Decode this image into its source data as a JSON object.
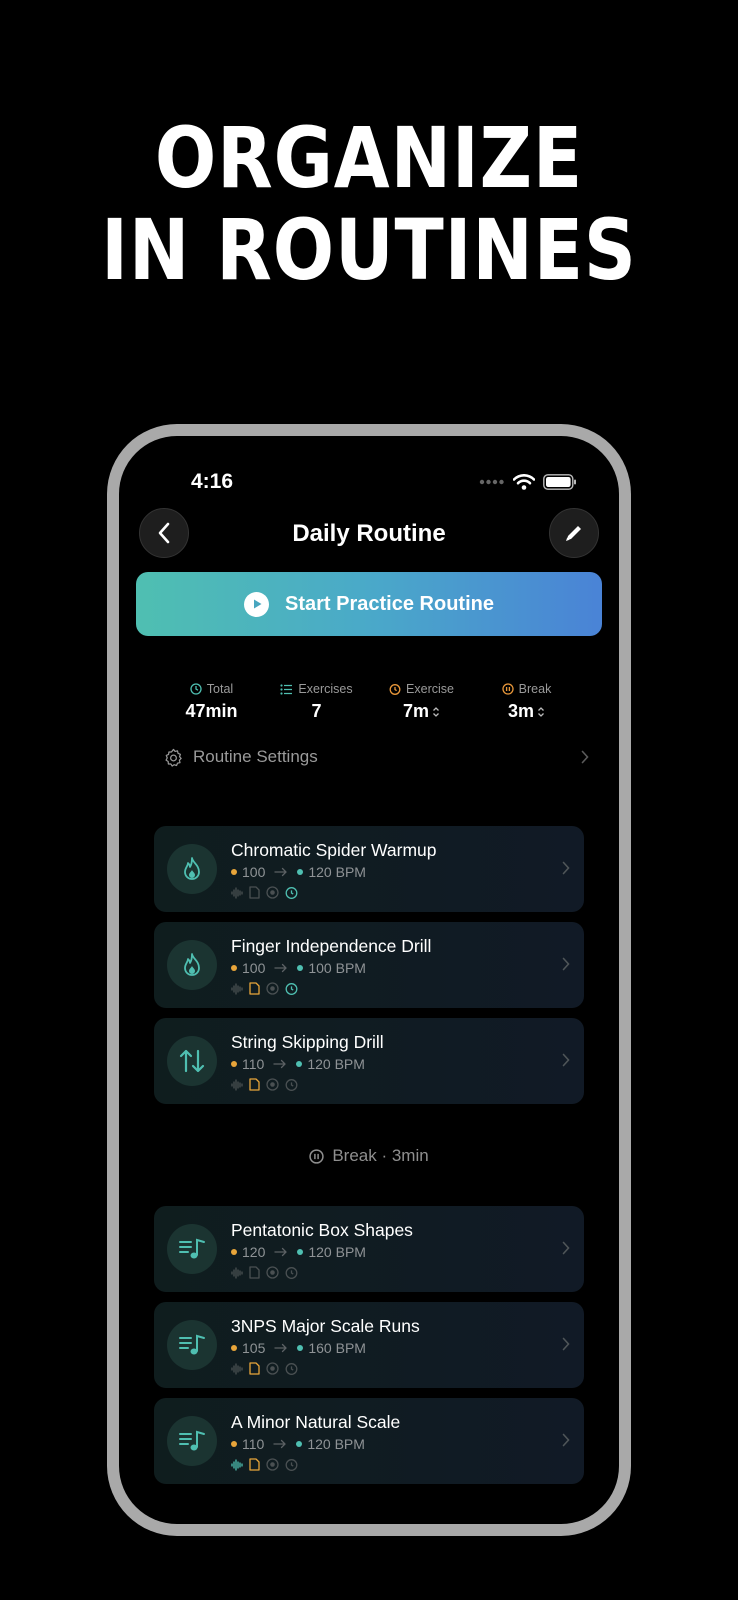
{
  "headline": {
    "line1": "ORGANIZE",
    "line2": "IN ROUTINES"
  },
  "status_bar": {
    "time": "4:16"
  },
  "nav": {
    "title": "Daily Routine"
  },
  "start_button": {
    "label": "Start Practice Routine"
  },
  "stats": [
    {
      "label": "Total",
      "value": "47min",
      "icon": "clock-icon",
      "color": "#4fbfb1"
    },
    {
      "label": "Exercises",
      "value": "7",
      "icon": "list-icon",
      "color": "#4fbfb1"
    },
    {
      "label": "Exercise",
      "value": "7m",
      "icon": "timer-icon",
      "color": "#e8973a"
    },
    {
      "label": "Break",
      "value": "3m",
      "icon": "pause-icon",
      "color": "#e8973a"
    }
  ],
  "settings": {
    "label": "Routine Settings"
  },
  "exercises": [
    {
      "title": "Chromatic Spider Warmup",
      "start": "100",
      "end": "120 BPM",
      "icon": "flame-icon",
      "tags": [
        "dim",
        "dim",
        "dim",
        "teal"
      ]
    },
    {
      "title": "Finger Independence Drill",
      "start": "100",
      "end": "100 BPM",
      "icon": "flame-icon",
      "tags": [
        "dim",
        "orange",
        "dim",
        "teal"
      ]
    },
    {
      "title": "String Skipping Drill",
      "start": "110",
      "end": "120 BPM",
      "icon": "arrows-updown-icon",
      "tags": [
        "dim",
        "orange",
        "dim",
        "dim"
      ]
    },
    {
      "title": "Pentatonic Box Shapes",
      "start": "120",
      "end": "120 BPM",
      "icon": "music-list-icon",
      "tags": [
        "dim",
        "dim",
        "dim",
        "dim"
      ]
    },
    {
      "title": "3NPS Major Scale Runs",
      "start": "105",
      "end": "160 BPM",
      "icon": "music-list-icon",
      "tags": [
        "dim",
        "orange",
        "dim",
        "dim"
      ]
    },
    {
      "title": "A Minor Natural Scale",
      "start": "110",
      "end": "120 BPM",
      "icon": "music-list-icon",
      "tags": [
        "teal",
        "orange",
        "dim",
        "dim"
      ]
    }
  ],
  "break_row": {
    "label": "Break · 3min"
  },
  "colors": {
    "accent_teal": "#4fbfb1",
    "accent_orange": "#e8a53a",
    "accent_blue": "#4a83d6"
  }
}
